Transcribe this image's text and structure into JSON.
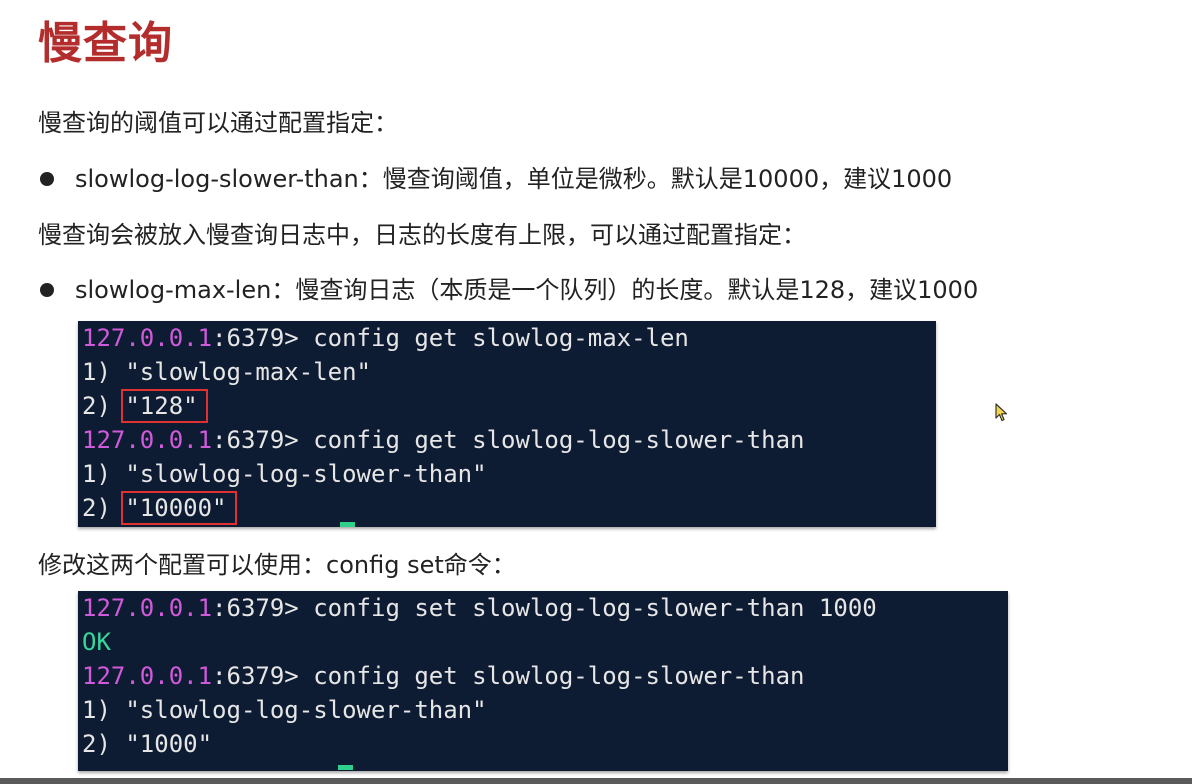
{
  "title": "慢查询",
  "intro": "慢查询的阈值可以通过配置指定：",
  "bullet1": {
    "key": "slowlog-log-slower-than",
    "desc": "：慢查询阈值，单位是微秒。默认是10000，建议1000"
  },
  "para2": "慢查询会被放入慢查询日志中，日志的长度有上限，可以通过配置指定：",
  "bullet2": {
    "key": "slowlog-max-len",
    "desc": "：慢查询日志（本质是一个队列）的长度。默认是128，建议1000"
  },
  "terminal1": {
    "prompt_ip": "127.0.0.1",
    "prompt_port": ":6379> ",
    "cmd1": "config get slowlog-max-len",
    "line2": "1) \"slowlog-max-len\"",
    "line3_prefix": "2) ",
    "line3_value": "\"128\"",
    "cmd2": "config get slowlog-log-slower-than",
    "line5": "1) \"slowlog-log-slower-than\"",
    "line6_prefix": "2) ",
    "line6_value": "\"10000\""
  },
  "para3": "修改这两个配置可以使用：config set命令：",
  "terminal2": {
    "prompt_ip": "127.0.0.1",
    "prompt_port": ":6379> ",
    "cmd1": "config set slowlog-log-slower-than 1000",
    "ok": "OK",
    "cmd2": "config get slowlog-log-slower-than",
    "line4": "1) \"slowlog-log-slower-than\"",
    "line5": "2) \"1000\""
  },
  "colors": {
    "title": "#b32d2d",
    "terminal_bg": "#0e1c33",
    "prompt_ip": "#d05ad9",
    "ok": "#37d79a",
    "highlight_box": "#e03030"
  }
}
